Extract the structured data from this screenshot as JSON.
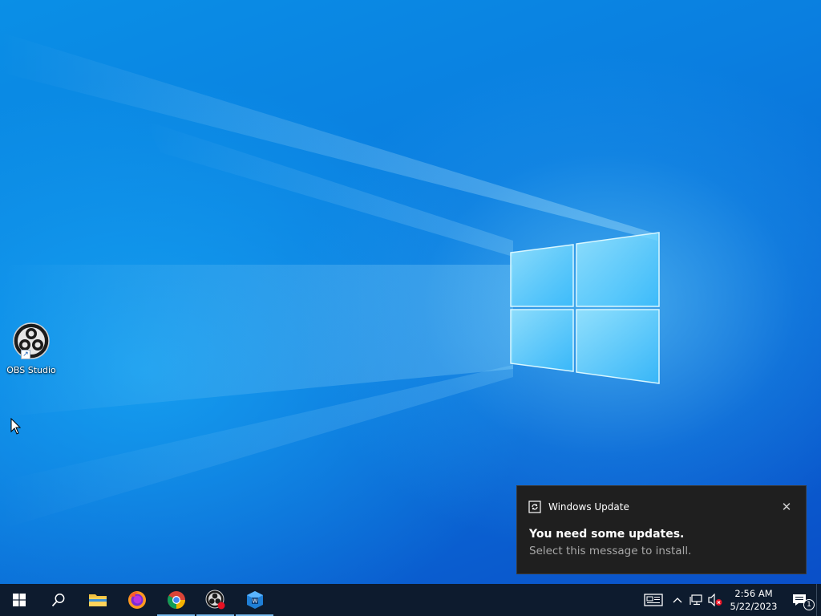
{
  "desktop": {
    "icons": [
      {
        "label": "OBS Studio",
        "icon": "obs-studio-icon"
      }
    ]
  },
  "toast": {
    "app_icon": "windows-update-icon",
    "app_name": "Windows Update",
    "close_glyph": "✕",
    "title": "You need some updates.",
    "body": "Select this message to install."
  },
  "taskbar": {
    "buttons": [
      {
        "name": "start",
        "icon": "windows-start-icon",
        "active": false
      },
      {
        "name": "search",
        "icon": "search-icon",
        "active": false
      },
      {
        "name": "file-explorer",
        "icon": "folder-icon",
        "active": false
      },
      {
        "name": "firefox",
        "icon": "firefox-icon",
        "active": false
      },
      {
        "name": "chrome",
        "icon": "chrome-icon",
        "active": true
      },
      {
        "name": "obs-studio",
        "icon": "obs-studio-icon",
        "active": true
      },
      {
        "name": "app",
        "icon": "blue-app-icon",
        "active": true
      }
    ],
    "tray": {
      "icons": [
        "news-and-interests-icon",
        "chevron-up-icon",
        "network-icon",
        "volume-muted-icon"
      ],
      "time": "2:56 AM",
      "date": "5/22/2023",
      "notification_count": "1"
    }
  },
  "colors": {
    "taskbar_bg": "#0d1b2e",
    "toast_bg": "#1f1f1f",
    "active_indicator": "#76b9ed",
    "desktop_blue": "#0a7fe0"
  }
}
